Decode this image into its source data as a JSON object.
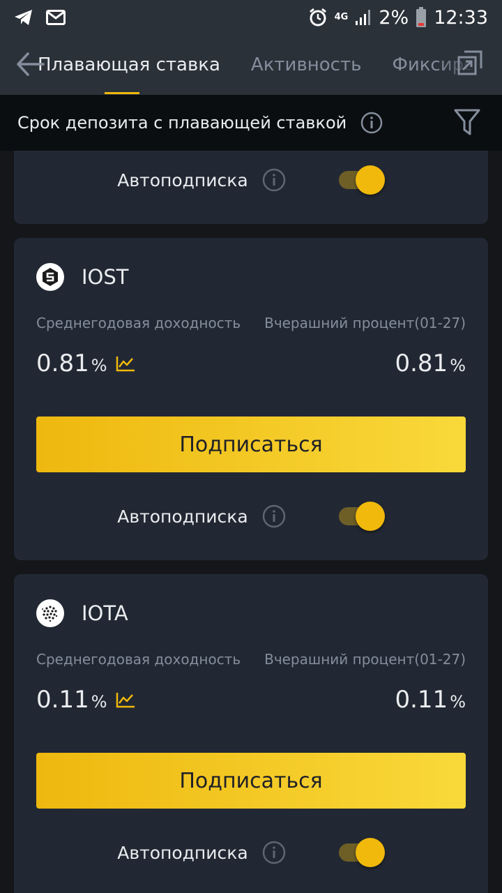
{
  "status_bar": {
    "network": "4G",
    "battery": "2%",
    "time": "12:33",
    "icons": [
      "telegram-icon",
      "mail-icon",
      "alarm-icon",
      "signal-icon",
      "battery-icon"
    ]
  },
  "header": {
    "tabs": [
      {
        "label": "Плавающая ставка",
        "active": true
      },
      {
        "label": "Активность",
        "active": false
      },
      {
        "label": "Фиксирован",
        "active": false
      }
    ]
  },
  "filter": {
    "title": "Срок депозита с плавающей ставкой"
  },
  "partial_card": {
    "auto_label": "Автоподписка",
    "auto_enabled": true
  },
  "products": [
    {
      "coin": "IOST",
      "apy_label": "Среднегодовая доходность",
      "yesterday_label": "Вчерашний процент(01-27)",
      "apy_value": "0.81",
      "yesterday_value": "0.81",
      "percent_sign": "%",
      "button_label": "Подписаться",
      "auto_label": "Автоподписка",
      "auto_enabled": true
    },
    {
      "coin": "IOTA",
      "apy_label": "Среднегодовая доходность",
      "yesterday_label": "Вчерашний процент(01-27)",
      "apy_value": "0.11",
      "yesterday_value": "0.11",
      "percent_sign": "%",
      "button_label": "Подписаться",
      "auto_label": "Автоподписка",
      "auto_enabled": true
    }
  ],
  "colors": {
    "accent": "#f0b90b",
    "card": "#222833",
    "header": "#2b3139"
  }
}
